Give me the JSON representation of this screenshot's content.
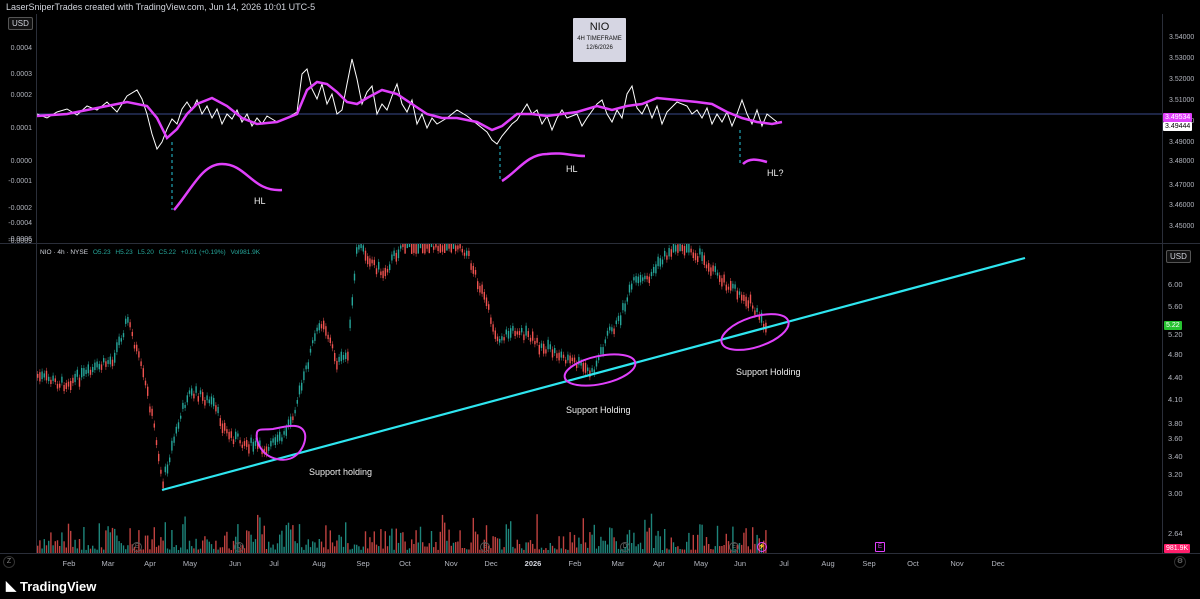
{
  "header": {
    "credit": "LaserSniperTrades created with TradingView.com, Jun 14, 2026 10:01 UTC-5"
  },
  "title_box": {
    "ticker": "NIO",
    "timeframe": "4H TIMEFRAME",
    "date": "12/6/2026"
  },
  "indicator_pane": {
    "currency_label": "USD",
    "left_ticks": [
      "0.0004",
      "0.0003",
      "0.0002",
      "0.0001",
      "0.0000",
      "-0.0001",
      "-0.0002",
      "-0.0004",
      "-0.0006",
      "-0.0009"
    ],
    "right_ticks": [
      "3.54000",
      "3.53000",
      "3.52000",
      "3.51000",
      "3.50000",
      "3.49000",
      "3.48000",
      "3.47000",
      "3.46000",
      "3.45000"
    ],
    "badge_magenta": "3.49534",
    "badge_white": "3.49444",
    "annotations": [
      "HL",
      "HL",
      "HL?"
    ],
    "colors": {
      "line": "#ffffff",
      "smooth": "#e040fb",
      "dash": "#26c6da"
    }
  },
  "price_pane": {
    "currency_label": "USD",
    "info": {
      "symbol": "NIO · 4h · NYSE",
      "open": "O5.23",
      "high": "H5.23",
      "low": "L5.20",
      "close": "C5.22",
      "change": "+0.01 (+0.19%)",
      "volume": "Vol981.9K"
    },
    "price_ticks": [
      "6.00",
      "5.60",
      "5.20",
      "4.80",
      "4.40",
      "4.10",
      "3.80",
      "3.60",
      "3.40",
      "3.20",
      "3.00",
      "2.64"
    ],
    "last_price_badge": "5.22",
    "volume_badge": "981.9K",
    "annotations": [
      "Support holding",
      "Support Holding",
      "Support Holding"
    ],
    "colors": {
      "up": "#26a69a",
      "down": "#ef5350",
      "trend": "#2ee6f0",
      "circle": "#e040fb"
    }
  },
  "x_axis": {
    "labels": [
      "Feb",
      "Mar",
      "Apr",
      "May",
      "Jun",
      "Jul",
      "Aug",
      "Sep",
      "Oct",
      "Nov",
      "Dec",
      "2026",
      "Feb",
      "Mar",
      "Apr",
      "May",
      "Jun",
      "Jul",
      "Aug",
      "Sep",
      "Oct",
      "Nov",
      "Dec"
    ]
  },
  "footer": {
    "brand": "TradingView"
  }
}
